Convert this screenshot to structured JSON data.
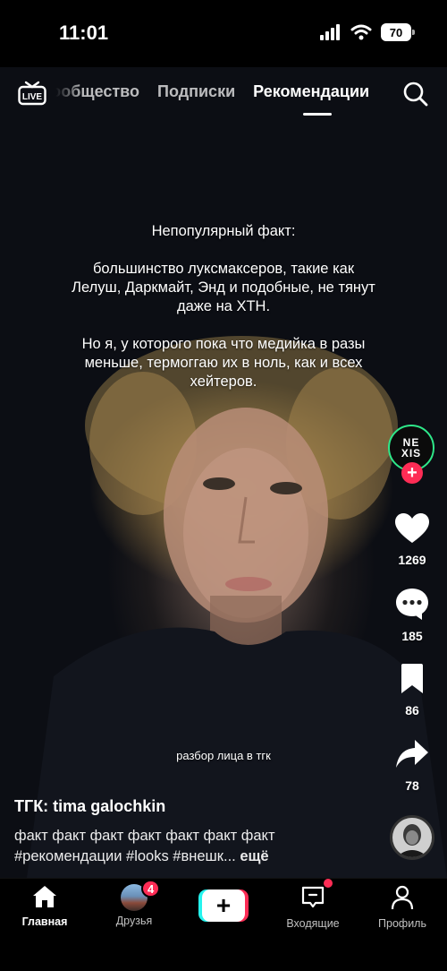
{
  "status_bar": {
    "time": "11:01",
    "battery": "70"
  },
  "top_nav": {
    "live_label": "LIVE",
    "tabs": [
      {
        "label": "Сообщество",
        "active": false
      },
      {
        "label": "Подписки",
        "active": false
      },
      {
        "label": "Рекомендации",
        "active": true
      }
    ]
  },
  "video": {
    "overlay_paragraphs": [
      "Непопулярный факт:",
      "большинство луксмаксеров, такие как Лелуш, Даркмайт, Энд и подобные, не тянут даже на ХТН.",
      "Но я, у которого пока что медийка в разы меньше, термоггаю их в ноль, как и всех хейтеров."
    ],
    "caption": "разбор лица в тгк"
  },
  "actions": {
    "brand_avatar_line1": "NE",
    "brand_avatar_line2": "XIS",
    "follow_plus": "+",
    "likes": "1269",
    "comments": "185",
    "bookmarks": "86",
    "shares": "78"
  },
  "post": {
    "author": "ТГК: tima galochkin",
    "description": "факт факт факт факт факт факт факт #рекомендации #looks #внешк...",
    "more": "ещё"
  },
  "bottom_bar": {
    "home_label": "Главная",
    "friends_label": "Друзья",
    "friends_badge": "4",
    "create_label": "+",
    "inbox_label": "Входящие",
    "profile_label": "Профиль"
  },
  "colors": {
    "accent": "#fe2c55",
    "brand_ring": "#2ee88a",
    "create_cyan": "#25f4ee",
    "create_red": "#fe2c55"
  }
}
